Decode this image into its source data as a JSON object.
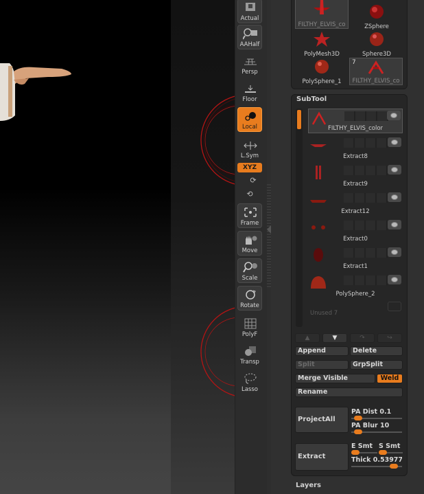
{
  "tool_palette": {
    "items": [
      {
        "label": "FILTHY_ELVIS_co",
        "icon": "filthy-elvis-thumbnail",
        "selected": true
      },
      {
        "label": "ZSphere",
        "icon": "zsphere-thumbnail"
      },
      {
        "label": "PolyMesh3D",
        "icon": "polymesh3d-star-thumbnail"
      },
      {
        "label": "Sphere3D",
        "icon": "sphere3d-thumbnail"
      },
      {
        "label": "PolySphere_1",
        "icon": "polysphere-thumbnail"
      },
      {
        "label": "FILTHY_ELVIS_co",
        "icon": "filthy-elvis-thumbnail",
        "badge": "7",
        "selected": true
      }
    ]
  },
  "left_dock": {
    "buttons": [
      {
        "label": "Actual"
      },
      {
        "label": "AAHalf"
      },
      {
        "label": "Persp"
      },
      {
        "label": "Floor"
      },
      {
        "label": "Local",
        "active": true
      },
      {
        "label": "L.Sym"
      },
      {
        "label": "XYZ",
        "active": true
      },
      {
        "label": "Frame"
      },
      {
        "label": "Move"
      },
      {
        "label": "Scale"
      },
      {
        "label": "Rotate"
      },
      {
        "label": "PolyF"
      },
      {
        "label": "Transp"
      },
      {
        "label": "Lasso"
      }
    ]
  },
  "subtool": {
    "title": "SubTool",
    "items": [
      {
        "label": "FILTHY_ELVIS_color",
        "selected": true
      },
      {
        "label": "Extract8"
      },
      {
        "label": "Extract9"
      },
      {
        "label": "Extract12"
      },
      {
        "label": "Extract0"
      },
      {
        "label": "Extract1"
      },
      {
        "label": "PolySphere_2"
      }
    ],
    "unused": "Unused 7",
    "buttons": {
      "append": "Append",
      "delete": "Delete",
      "split": "Split",
      "grpsplit": "GrpSplit",
      "merge_visible": "Merge Visible",
      "weld": "Weld",
      "rename": "Rename",
      "projectall": "ProjectAll",
      "extract": "Extract"
    },
    "sliders": {
      "pa_dist": "PA Dist 0.1",
      "pa_blur": "PA Blur 10",
      "e_smt": "E Smt",
      "s_smt": "S Smt",
      "thick": "Thick 0.53977"
    }
  },
  "layers": {
    "title": "Layers"
  },
  "colors": {
    "accent": "#e87c1e",
    "gizmo": "#c21818"
  }
}
